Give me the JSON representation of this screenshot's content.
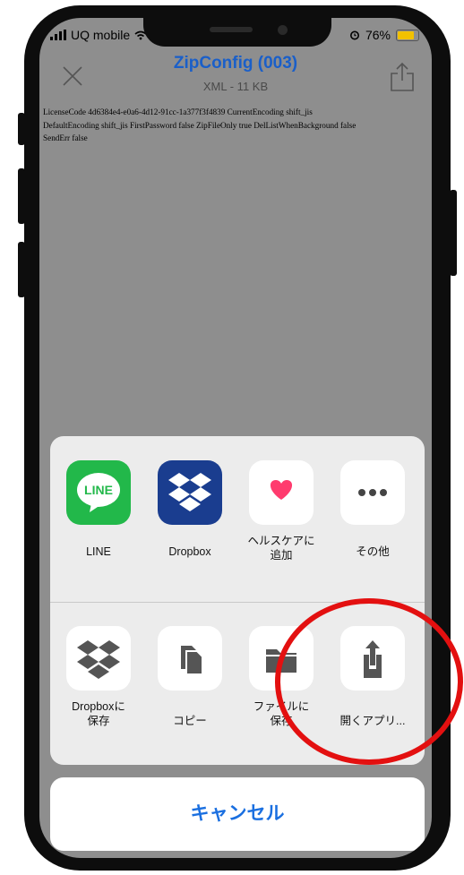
{
  "status_bar": {
    "carrier": "UQ mobile",
    "battery": "76%",
    "battery_color": "#f2c100"
  },
  "header": {
    "title": "ZipConfig (003)",
    "subtitle": "XML - 11 KB",
    "title_color": "#1a5fc9",
    "close_icon": "close-icon",
    "share_icon": "share-icon"
  },
  "document": {
    "line1": "LicenseCode 4d6384e4-e0a6-4d12-91cc-1a377f3f4839 CurrentEncoding shift_jis",
    "line2": "DefaultEncoding shift_jis FirstPassword false ZipFileOnly true DelListWhenBackground false",
    "line3": "SendErr false"
  },
  "share_sheet": {
    "apps": [
      {
        "label": "LINE",
        "icon": "line-app-icon",
        "color": "#22b84a"
      },
      {
        "label": "Dropbox",
        "icon": "dropbox-app-icon",
        "color": "#1a3d8f"
      },
      {
        "label": "ヘルスケアに\n追加",
        "icon": "health-heart-icon",
        "color": "#ff3b6e"
      },
      {
        "label": "その他",
        "icon": "more-icon"
      }
    ],
    "actions": [
      {
        "label": "Dropboxに\n保存",
        "icon": "dropbox-save-icon"
      },
      {
        "label": "コピー",
        "icon": "copy-icon"
      },
      {
        "label": "ファイルに\n保存",
        "icon": "folder-icon"
      },
      {
        "label": "開くアプリ...",
        "icon": "open-in-app-icon"
      }
    ]
  },
  "cancel_label": "キャンセル",
  "annotation_color": "#e31010"
}
